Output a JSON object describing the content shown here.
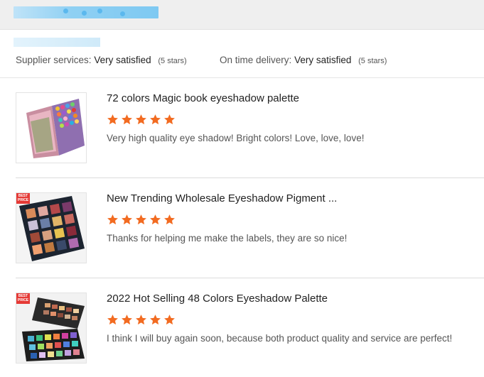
{
  "header": {
    "title_blurred": true,
    "subtitle_blurred": true
  },
  "ratings": {
    "supplier_label": "Supplier services:",
    "supplier_value": "Very satisfied",
    "supplier_stars": "(5 stars)",
    "delivery_label": "On time delivery:",
    "delivery_value": "Very satisfied",
    "delivery_stars": "(5 stars)"
  },
  "reviews": [
    {
      "title": "72 colors Magic book eyeshadow palette",
      "rating": 5,
      "text": "Very high quality eye shadow! Bright colors! Love, love, love!",
      "badge": ""
    },
    {
      "title": "New Trending Wholesale Eyeshadow Pigment ...",
      "rating": 5,
      "text": "Thanks for helping me make the labels, they are so nice!",
      "badge": "BEST PRICE"
    },
    {
      "title": "2022 Hot Selling 48 Colors Eyeshadow Palette",
      "rating": 5,
      "text": "I think I will buy again soon, because both product quality and service are perfect!",
      "badge": "BEST PRICE"
    }
  ],
  "colors": {
    "star": "#f26b21",
    "header_bg": "#efefef",
    "blur_blue": "#7ec9f2"
  }
}
